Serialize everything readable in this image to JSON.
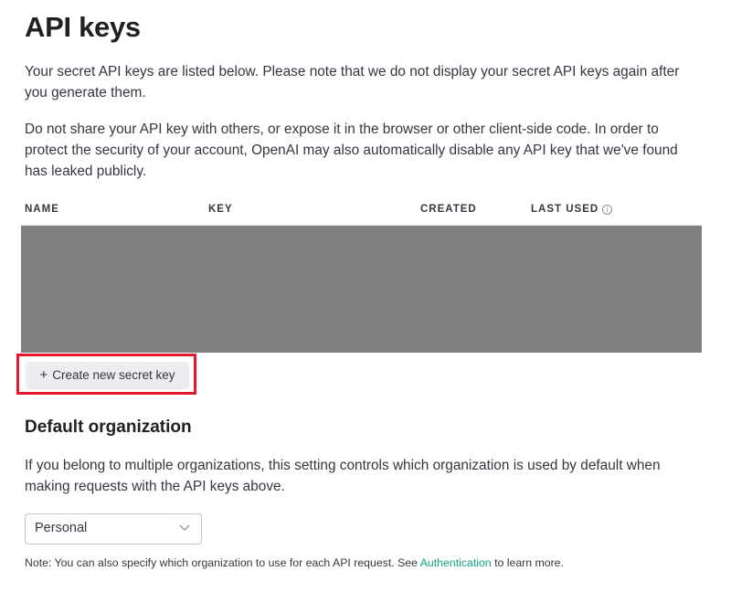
{
  "page": {
    "title": "API keys",
    "intro_1": "Your secret API keys are listed below. Please note that we do not display your secret API keys again after you generate them.",
    "intro_2": "Do not share your API key with others, or expose it in the browser or other client-side code. In order to protect the security of your account, OpenAI may also automatically disable any API key that we've found has leaked publicly."
  },
  "table": {
    "columns": [
      "NAME",
      "KEY",
      "CREATED",
      "LAST USED"
    ],
    "last_used_info_icon": "info-icon",
    "rows": []
  },
  "actions": {
    "create_icon": "+",
    "create_label": "Create new secret key"
  },
  "default_org": {
    "heading": "Default organization",
    "description": "If you belong to multiple organizations, this setting controls which organization is used by default when making requests with the API keys above.",
    "selected": "Personal",
    "note_prefix": "Note: You can also specify which organization to use for each API request. See ",
    "note_link": "Authentication",
    "note_suffix": " to learn more."
  },
  "colors": {
    "highlight": "#e21a2c",
    "link": "#10a37f",
    "redacted": "#808080",
    "button_bg": "#ececf1"
  }
}
